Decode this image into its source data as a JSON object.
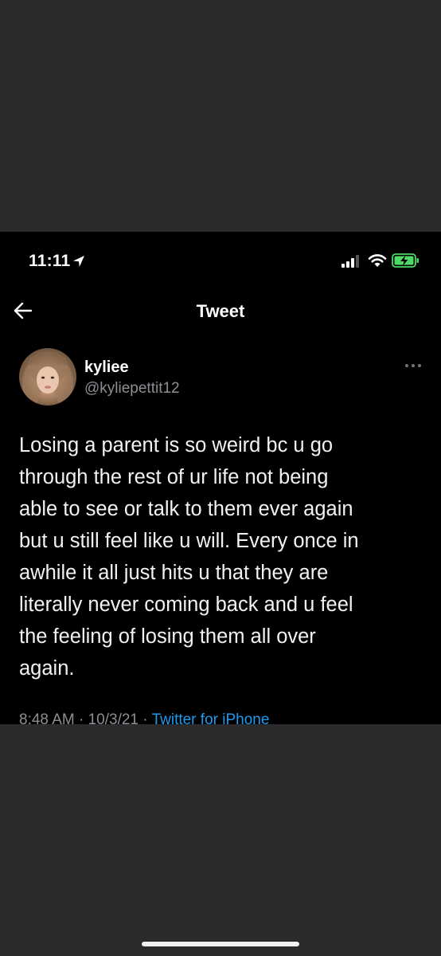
{
  "status_bar": {
    "time": "11:11",
    "icons": [
      "location-arrow-icon",
      "cellular-signal-icon",
      "wifi-icon",
      "battery-charging-icon"
    ]
  },
  "nav": {
    "back_icon": "back-arrow-icon",
    "title": "Tweet"
  },
  "tweet": {
    "author": {
      "display_name": "kyliee",
      "handle": "@kyliepettit12",
      "avatar_icon": "profile-photo"
    },
    "more_icon": "more-dots-icon",
    "text": "Losing a parent is so weird bc u go\nthrough the rest of ur life not being\nable to see or talk to them ever again\nbut u still feel like u will. Every once in\nawhile it all just hits u that they are\nliterally never coming back and u feel\nthe feeling of losing them all over\nagain.",
    "time": "8:48 AM",
    "separator": "·",
    "date": "10/3/21",
    "source": "Twitter for iPhone"
  },
  "colors": {
    "background": "#2b2b2d",
    "screen": "#000000",
    "text": "#f2f2f2",
    "muted": "#8b8f94",
    "link": "#1d9bf0",
    "battery_charge": "#4cd964"
  }
}
